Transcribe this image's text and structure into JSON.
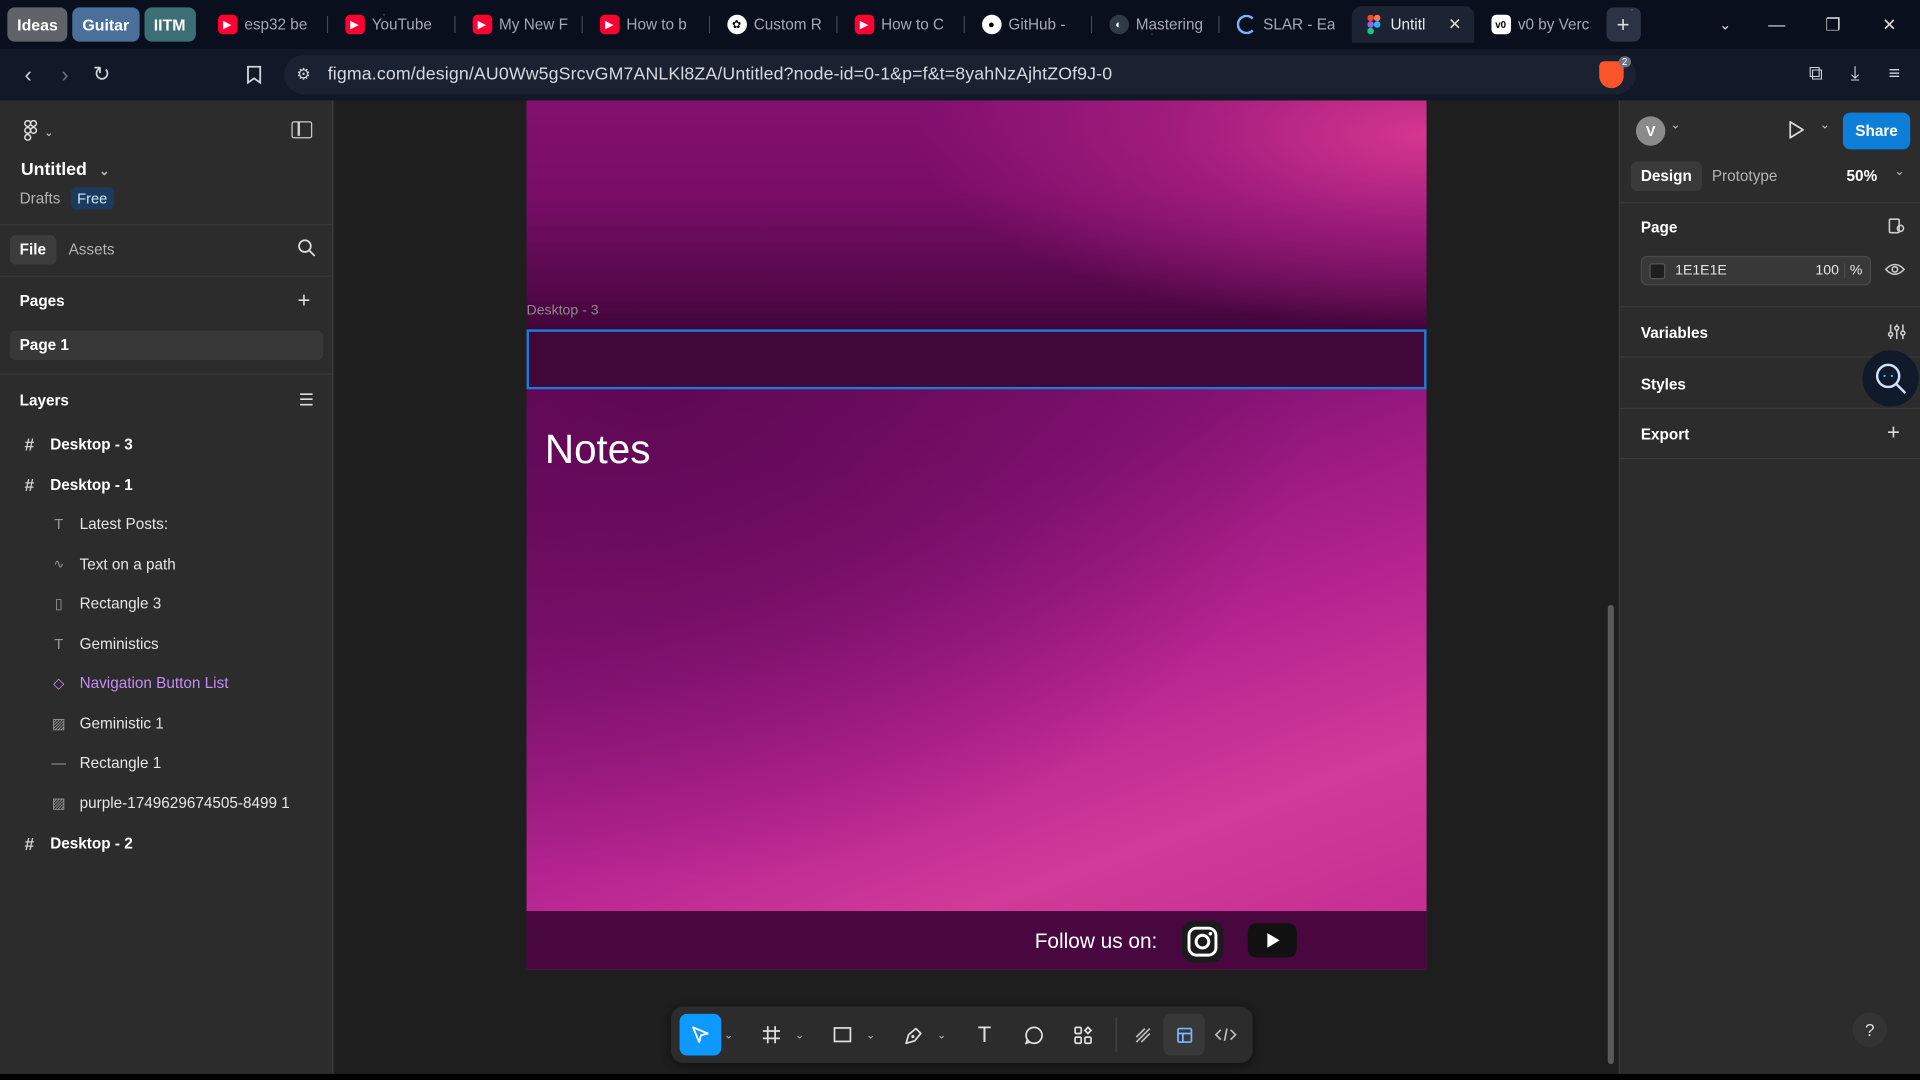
{
  "browser": {
    "tab_groups": [
      {
        "label": "Ideas",
        "color": "#5f6368"
      },
      {
        "label": "Guitar",
        "color": "#4a6f9a"
      },
      {
        "label": "IITM",
        "color": "#3b6e75"
      }
    ],
    "tabs": [
      {
        "title": "esp32 be",
        "icon": "youtube-icon"
      },
      {
        "title": "YouTube",
        "icon": "youtube-icon"
      },
      {
        "title": "My New F",
        "icon": "youtube-icon"
      },
      {
        "title": "How to b",
        "icon": "youtube-icon"
      },
      {
        "title": "Custom R",
        "icon": "chatgpt-icon"
      },
      {
        "title": "How to C",
        "icon": "youtube-icon"
      },
      {
        "title": "GitHub -",
        "icon": "github-icon"
      },
      {
        "title": "Mastering",
        "icon": "site-icon"
      },
      {
        "title": "SLAR - Ea",
        "icon": "loading-icon"
      },
      {
        "title": "Untitl",
        "icon": "figma-icon",
        "active": true
      },
      {
        "title": "v0 by Verc",
        "icon": "v0-icon"
      }
    ],
    "url": "figma.com/design/AU0Ww5gSrcvGM7ANLKl8ZA/Untitled?node-id=0-1&p=f&t=8yahNzAjhtZOf9J-0",
    "shield_badge": "2"
  },
  "left_panel": {
    "file_name": "Untitled",
    "drafts_label": "Drafts",
    "plan_badge": "Free",
    "tabs": [
      "File",
      "Assets"
    ],
    "pages_header": "Pages",
    "pages": [
      "Page 1"
    ],
    "layers_header": "Layers",
    "layers": [
      {
        "name": "Desktop - 3",
        "icon": "frame-icon",
        "level": 0
      },
      {
        "name": "Desktop - 1",
        "icon": "frame-icon",
        "level": 0
      },
      {
        "name": "Latest Posts:",
        "icon": "text-icon",
        "level": 1
      },
      {
        "name": "Text on a path",
        "icon": "path-icon",
        "level": 1
      },
      {
        "name": "Rectangle 3",
        "icon": "rectangle-icon",
        "level": 1
      },
      {
        "name": "Geministics",
        "icon": "text-icon",
        "level": 1
      },
      {
        "name": "Navigation Button List",
        "icon": "component-icon",
        "level": 1,
        "color": "#c58cf7"
      },
      {
        "name": "Geministic 1",
        "icon": "image-icon",
        "level": 1
      },
      {
        "name": "Rectangle 1",
        "icon": "line-icon",
        "level": 1
      },
      {
        "name": "purple-1749629674505-8499 1",
        "icon": "image-icon",
        "level": 1
      },
      {
        "name": "Desktop - 2",
        "icon": "frame-icon",
        "level": 0
      }
    ]
  },
  "canvas": {
    "frame_label": "Desktop - 3",
    "notes_heading": "Notes",
    "follow_text": "Follow us on:",
    "social_icons": [
      "instagram-icon",
      "youtube-icon"
    ]
  },
  "right_panel": {
    "avatar_letter": "V",
    "share_label": "Share",
    "tabs": [
      "Design",
      "Prototype"
    ],
    "zoom": "50%",
    "page_header": "Page",
    "page_fill_hex": "1E1E1E",
    "page_fill_opacity": "100",
    "percent_sign": "%",
    "sections": [
      "Variables",
      "Styles",
      "Export"
    ],
    "help": "?"
  }
}
